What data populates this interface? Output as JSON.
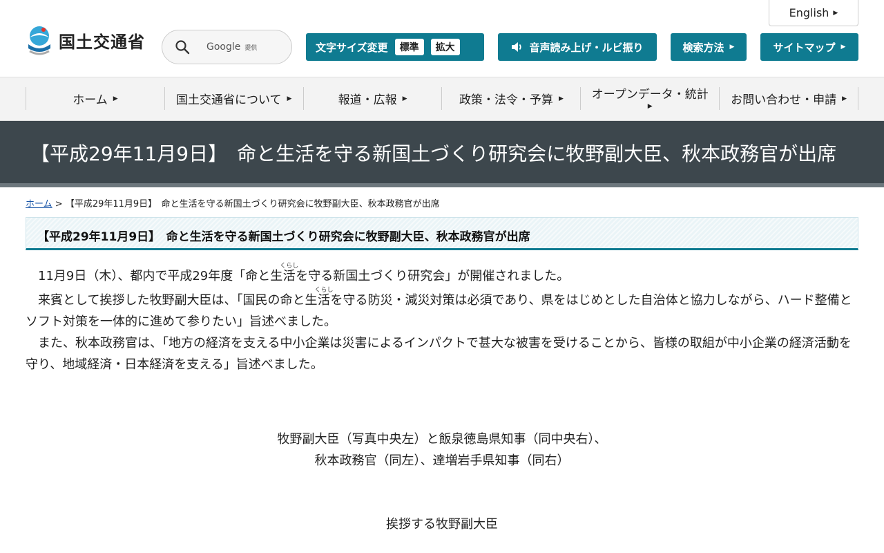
{
  "header": {
    "english_label": "English",
    "logo_text": "国土交通省",
    "search": {
      "brand": "Google",
      "provided": "提供"
    },
    "font_size": {
      "label": "文字サイズ変更",
      "standard": "標準",
      "large": "拡大"
    },
    "voice_label": "音声読み上げ・ルビ振り",
    "search_method_label": "検索方法",
    "sitemap_label": "サイトマップ"
  },
  "colors": {
    "accent": "#0f7b91",
    "title_band": "#3d474d"
  },
  "nav": {
    "items": [
      {
        "label": "ホーム"
      },
      {
        "label": "国土交通省について"
      },
      {
        "label": "報道・広報"
      },
      {
        "label": "政策・法令・予算"
      },
      {
        "label": "オープンデータ・統計"
      },
      {
        "label": "お問い合わせ・申請"
      }
    ]
  },
  "page": {
    "title": "【平成29年11月9日】　命と生活を守る新国土づくり研究会に牧野副大臣、秋本政務官が出席",
    "breadcrumb": {
      "home": "ホーム",
      "separator": ">",
      "current": "【平成29年11月9日】　命と生活を守る新国土づくり研究会に牧野副大臣、秋本政務官が出席"
    },
    "heading": "【平成29年11月9日】　命と生活を守る新国土づくり研究会に牧野副大臣、秋本政務官が出席",
    "ruby_base": "活",
    "ruby_reading": "くらし",
    "p1_before": "11月9日（木）、都内で平成29年度「命と生",
    "p1_after": "を守る新国土づくり研究会」が開催されました。",
    "p2_before": "来賓として挨拶した牧野副大臣は、「国民の命と生",
    "p2_after": "を守る防災・減災対策は必須であり、県をはじめとした自治体と協力しながら、ハード整備とソフト対策を一体的に進めて参りたい」旨述べました。",
    "p3": "また、秋本政務官は、「地方の経済を支える中小企業は災害によるインパクトで甚大な被害を受けることから、皆様の取組が中小企業の経済活動を守り、地域経済・日本経済を支える」旨述べました。",
    "caption1_line1": "牧野副大臣（写真中央左）と飯泉徳島県知事（同中央右）、",
    "caption1_line2": "秋本政務官（同左）、達増岩手県知事（同右）",
    "caption2": "挨拶する牧野副大臣"
  }
}
